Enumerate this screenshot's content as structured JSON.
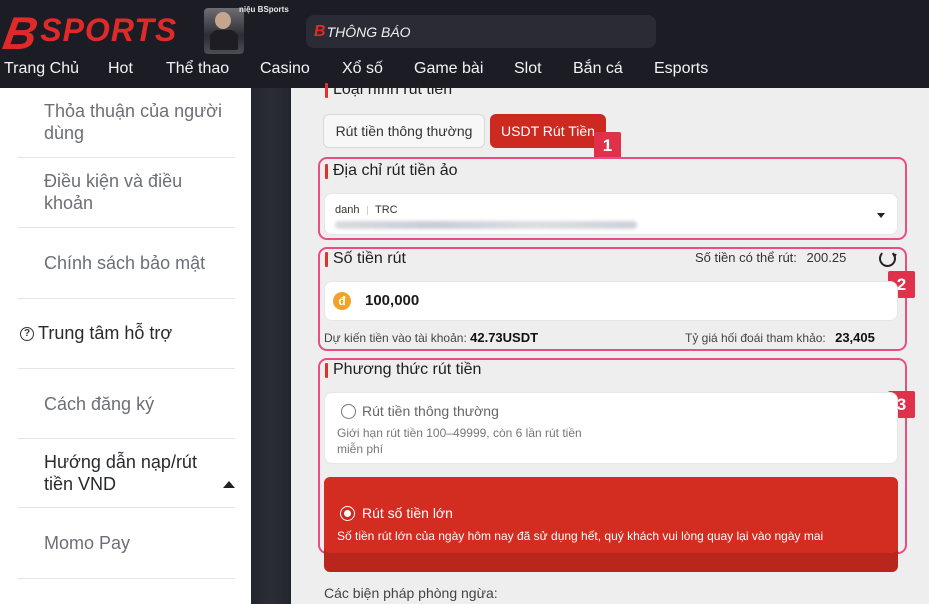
{
  "header": {
    "logo_b": "B",
    "logo_sports": "SPORTS",
    "ambassador_text": "niệu BSports",
    "notice_b": "B",
    "notice_text": "THÔNG BÁO"
  },
  "nav": [
    "Trang Chủ",
    "Hot",
    "Thể thao",
    "Casino",
    "Xổ số",
    "Game bài",
    "Slot",
    "Bắn cá",
    "Esports"
  ],
  "sidebar": {
    "items": [
      {
        "label": "Thỏa thuận của người dùng"
      },
      {
        "label": "Điều kiện và điều khoản"
      },
      {
        "label": "Chính sách bảo mật"
      },
      {
        "label": "Trung tâm hỗ trợ",
        "icon": "question-circle-icon"
      },
      {
        "label": "Cách đăng ký"
      },
      {
        "label": "Hướng dẫn nạp/rút tiền VND",
        "icon": "caret-up-icon"
      },
      {
        "label": "Momo Pay"
      }
    ]
  },
  "main": {
    "withdraw_type_title": "Loại hình rút tiền",
    "tab_normal": "Rút tiền thông thường",
    "tab_usdt": "USDT Rút Tiền",
    "badges": [
      "1",
      "2",
      "3"
    ],
    "virtual_address_title": "Địa chỉ rút tiền ảo",
    "address_label": "danh",
    "address_network": "TRC",
    "amount_title": "Số tiền rút",
    "available_label": "Số tiền có thể rút:",
    "available_value": "200.25",
    "amount_value": "100,000",
    "expected_label": "Dự kiến tiền vào tài khoản:",
    "expected_value": "42.73USDT",
    "rate_label": "Tỷ giá hối đoái tham khảo:",
    "rate_value": "23,405",
    "method_title": "Phương thức rút tiền",
    "method_normal_label": "Rút tiền thông thường",
    "method_normal_desc": "Giới hạn rút tiền 100–49999, còn 6 lần rút tiền miễn phí",
    "method_large_label": "Rút số tiền lớn",
    "method_large_desc": "Số tiền rút lớn của ngày hôm nay đã sử dụng hết, quý khách vui lòng quay lại vào ngày mai",
    "precautions_title": "Các biện pháp phòng ngừa:"
  },
  "colors": {
    "brand_red": "#e02a2a",
    "button_red": "#cc2a20",
    "highlight_pink": "#e84e86",
    "badge_pink": "#e0314b",
    "coin_orange": "#f2a22a"
  }
}
